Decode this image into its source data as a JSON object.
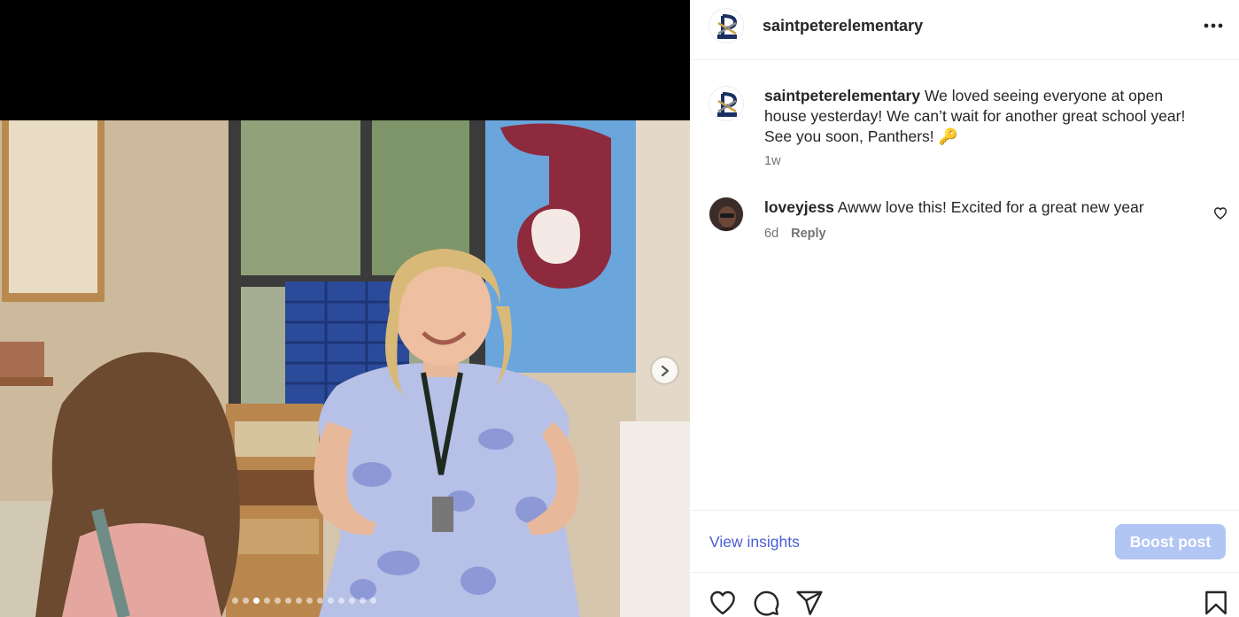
{
  "post": {
    "username": "saintpeterelementary",
    "caption": "We loved seeing everyone at open house yesterday! We can’t wait for another great school year! See you soon, Panthers! 🔑",
    "caption_time": "1w",
    "carousel": {
      "total_slides": 14,
      "current_slide": 3
    }
  },
  "header": {
    "username": "saintpeterelementary",
    "more_icon": "more-horizontal-icon"
  },
  "comments": [
    {
      "username": "loveyjess",
      "text": "Awww love this! Excited for a great new year",
      "time": "6d",
      "reply_label": "Reply"
    }
  ],
  "insights": {
    "view_label": "View insights",
    "boost_label": "Boost post"
  },
  "actions": {
    "icons": [
      "heart-icon",
      "comment-icon",
      "share-icon",
      "bookmark-icon"
    ]
  },
  "colors": {
    "link": "#4a5ed6",
    "boost_button": "#b2c6f5",
    "muted": "#737373"
  }
}
